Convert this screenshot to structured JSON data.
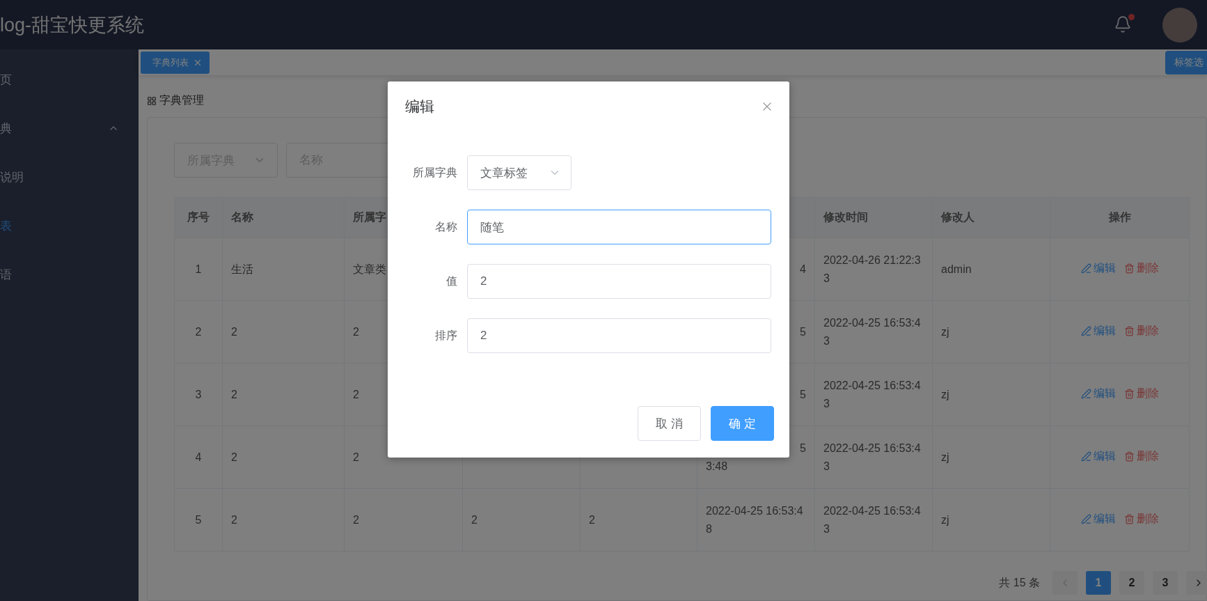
{
  "header": {
    "title": "log-甜宝快更系统",
    "notifications": {
      "unread": true
    }
  },
  "sidebar": {
    "items": [
      {
        "label": "页",
        "selected": false
      },
      {
        "label": "典",
        "selected": false,
        "expanded": true
      },
      {
        "label": "说明",
        "selected": false
      },
      {
        "label": "表",
        "selected": true
      },
      {
        "label": "语",
        "selected": false
      }
    ]
  },
  "tabs": [
    {
      "label": "字典列表",
      "selected": true
    }
  ],
  "tab_menu_button": "标签选",
  "breadcrumb": "字典管理",
  "filters": {
    "dictionary_select": {
      "placeholder": "所属字典"
    },
    "name_input": {
      "placeholder": "名称"
    }
  },
  "table": {
    "columns": [
      "序号",
      "名称",
      "所属字",
      null,
      null,
      null,
      "修改时间",
      "修改人",
      "操作"
    ],
    "rows": [
      {
        "cells": [
          "1",
          "生活",
          "文章类",
          null,
          null,
          "4",
          "2022-04-26 21:22:33",
          "admin"
        ],
        "actions": [
          {
            "kind": "edit",
            "label": "编辑"
          },
          {
            "kind": "delete",
            "label": "删除"
          }
        ]
      },
      {
        "cells": [
          "2",
          "2",
          "2",
          null,
          null,
          "5",
          "2022-04-25 16:53:43",
          "zj"
        ],
        "actions": [
          {
            "kind": "edit",
            "label": "编辑"
          },
          {
            "kind": "delete",
            "label": "删除"
          }
        ]
      },
      {
        "cells": [
          "3",
          "2",
          "2",
          null,
          null,
          "5",
          "2022-04-25 16:53:43",
          "zj"
        ],
        "actions": [
          {
            "kind": "edit",
            "label": "编辑"
          },
          {
            "kind": "delete",
            "label": "删除"
          }
        ]
      },
      {
        "cells": [
          "4",
          "2",
          "2",
          null,
          null,
          [
            "5",
            "3:48"
          ],
          "2022-04-25 16:53:43",
          "zj"
        ],
        "actions": [
          {
            "kind": "edit",
            "label": "编辑"
          },
          {
            "kind": "delete",
            "label": "删除"
          }
        ]
      },
      {
        "cells": [
          "5",
          "2",
          "2",
          "2",
          "2",
          "2022-04-25 16:53:48",
          "2022-04-25 16:53:43",
          "zj"
        ],
        "actions": [
          {
            "kind": "edit",
            "label": "编辑"
          },
          {
            "kind": "delete",
            "label": "删除"
          }
        ]
      }
    ]
  },
  "pagination": {
    "total": "共 15 条",
    "pages": [
      {
        "label": "1",
        "selected": true
      },
      {
        "label": "2",
        "selected": false
      },
      {
        "label": "3",
        "selected": false
      }
    ]
  },
  "dialog": {
    "title": "编辑",
    "fields": [
      {
        "kind": "select",
        "label": "所属字典",
        "value": "文章标签",
        "focused": false
      },
      {
        "kind": "input",
        "label": "名称",
        "value": "随笔",
        "focused": true
      },
      {
        "kind": "input",
        "label": "值",
        "value": "2",
        "focused": false
      },
      {
        "kind": "input",
        "label": "排序",
        "value": "2",
        "focused": false
      }
    ],
    "buttons": [
      {
        "kind": "secondary",
        "label": "取 消"
      },
      {
        "kind": "primary",
        "label": "确 定"
      }
    ]
  }
}
